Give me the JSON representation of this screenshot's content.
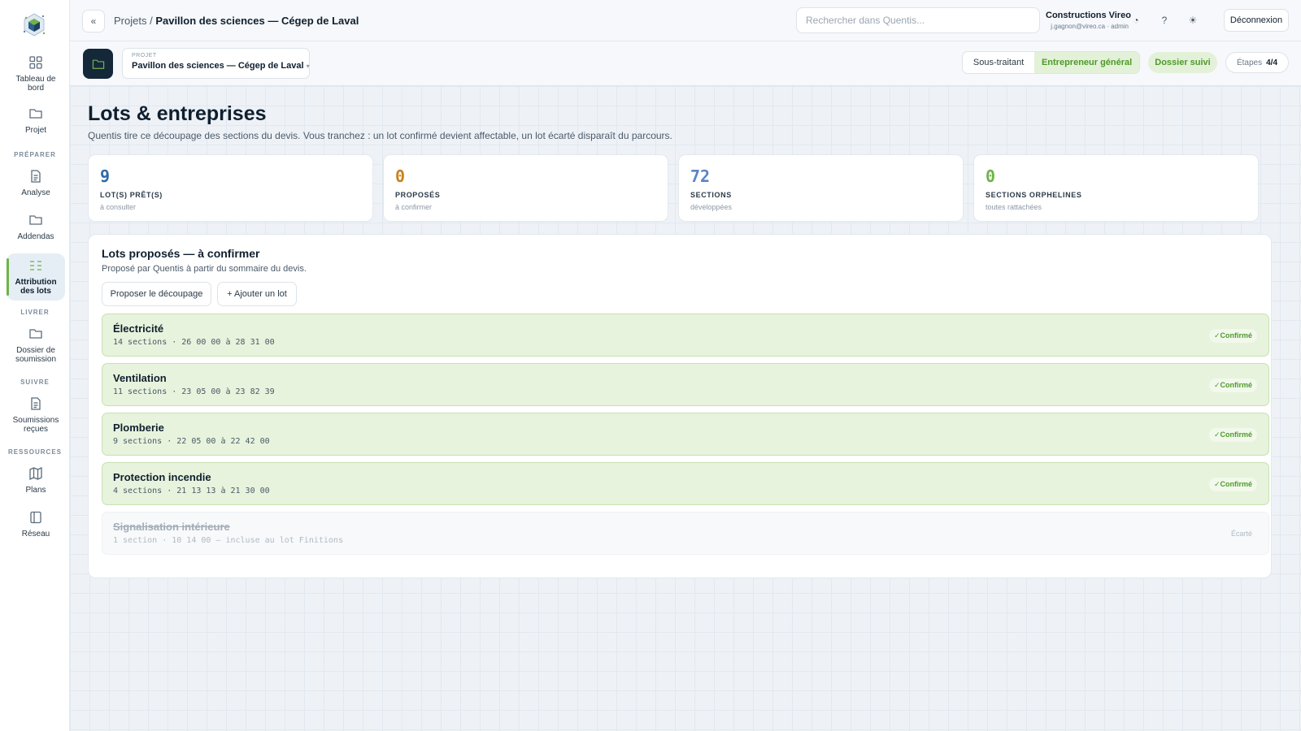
{
  "sidebar": {
    "logo": "cube-logo",
    "items": [
      {
        "label": "Tableau de bord",
        "icon": "grid-icon"
      },
      {
        "label": "Projet",
        "icon": "folder-icon"
      },
      {
        "label": "Analyse",
        "icon": "document-icon"
      },
      {
        "label": "Addendas",
        "icon": "folder-icon"
      },
      {
        "label": "Attribution des lots",
        "icon": "list-icon"
      },
      {
        "label": "Dossier de soumission",
        "icon": "folder-icon"
      },
      {
        "label": "Soumissions reçues",
        "icon": "document-icon"
      },
      {
        "label": "Plans",
        "icon": "map-icon"
      },
      {
        "label": "Réseau",
        "icon": "book-icon"
      }
    ],
    "sections": [
      "PRÉPARER",
      "LIVRER",
      "SUIVRE",
      "RESSOURCES"
    ],
    "active_item": "Attribution des lots"
  },
  "topbar": {
    "collapse": "«",
    "breadcrumb_root": "Projets /",
    "breadcrumb_current": "Pavillon des sciences — Cégep de Laval",
    "search_placeholder": "Rechercher dans Quentis...",
    "company_name": "Constructions Vireo",
    "user_email": "j.gagnon@vireo.ca · admin",
    "history_icon": "◔",
    "help_icon": "?",
    "theme_icon": "☀",
    "logout_label": "Déconnexion"
  },
  "projectbar": {
    "project_label": "PROJET",
    "project_name": "Pavillon des sciences — Cégep de Laval",
    "roles": [
      "Sous-traitant",
      "Entrepreneur général"
    ],
    "active_role": "Entrepreneur général",
    "followed_label": "Dossier suivi",
    "steps_label": "Étapes",
    "steps_value": "4/4"
  },
  "page": {
    "title": "Lots & entreprises",
    "description": "Quentis tire ce découpage des sections du devis. Vous tranchez : un lot confirmé devient affectable, un lot écarté disparaît du parcours."
  },
  "stats": [
    {
      "value": "9",
      "label": "LOT(S) PRÊT(S)",
      "sub": "à consulter",
      "color": "#2f6aa8"
    },
    {
      "value": "0",
      "label": "PROPOSÉS",
      "sub": "à confirmer",
      "color": "#c9821e"
    },
    {
      "value": "72",
      "label": "SECTIONS",
      "sub": "développées",
      "color": "#5b84c4"
    },
    {
      "value": "0",
      "label": "SECTIONS ORPHELINES",
      "sub": "toutes rattachées",
      "color": "#6fb34a"
    }
  ],
  "panel": {
    "title": "Lots proposés — à confirmer",
    "subtitle": "Proposé par Quentis à partir du sommaire du devis.",
    "propose_button": "Proposer le découpage",
    "add_button": "+ Ajouter un lot",
    "lots": [
      {
        "name": "Électricité",
        "meta": "14 sections · 26 00 00 à 28 31 00",
        "status": "✓Confirmé"
      },
      {
        "name": "Ventilation",
        "meta": "11 sections · 23 05 00 à 23 82 39",
        "status": "✓Confirmé"
      },
      {
        "name": "Plomberie",
        "meta": "9 sections · 22 05 00 à 22 42 00",
        "status": "✓Confirmé"
      },
      {
        "name": "Protection incendie",
        "meta": "4 sections · 21 13 13 à 21 30 00",
        "status": "✓Confirmé"
      },
      {
        "name": "Signalisation intérieure",
        "meta": "1 section · 10 14 00 — incluse au lot Finitions",
        "status": "Écarté"
      }
    ]
  },
  "colors": {
    "accent_green": "#6fb34a",
    "navy": "#14283a"
  }
}
